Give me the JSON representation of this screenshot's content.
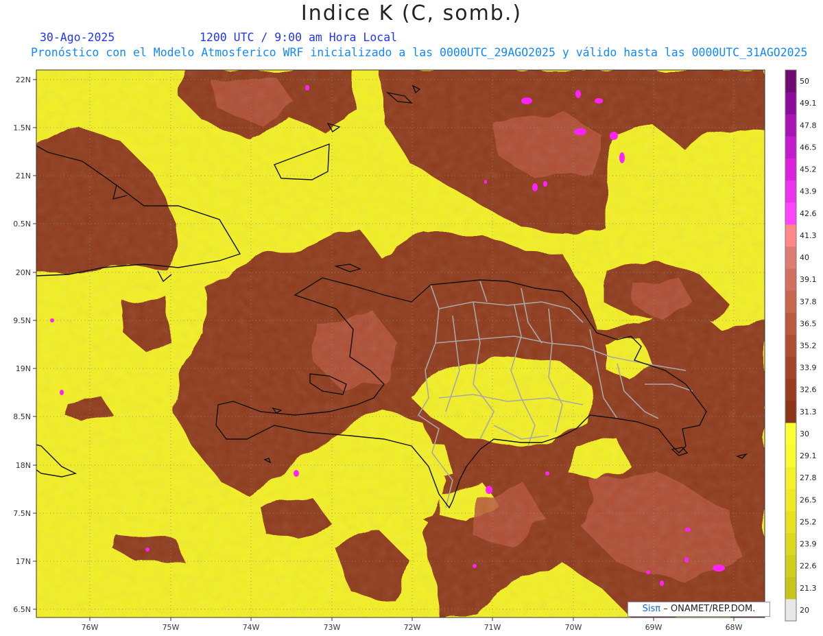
{
  "title": "Indice K (C, somb.)",
  "date_label": "30-Ago-2025",
  "time_label": "1200 UTC / 9:00 am Hora Local",
  "model_label": "Pronóstico con el Modelo Atmosferico WRF inicializado a las 0000UTC_29AGO2025 y válido hasta las  0000UTC_31AGO2025",
  "credit": {
    "logo": "Sisπ",
    "text": "– ONAMET/REP.DOM."
  },
  "axes": {
    "lat_labels": [
      "22N",
      "1.5N",
      "21N",
      "0.5N",
      "20N",
      "9.5N",
      "19N",
      "8.5N",
      "18N",
      "7.5N",
      "17N",
      "6.5N"
    ],
    "lon_labels": [
      "76W",
      "75W",
      "74W",
      "73W",
      "72W",
      "71W",
      "70W",
      "69W",
      "68W"
    ]
  },
  "colorbar": {
    "levels": [
      "20",
      "21.3",
      "22.6",
      "23.9",
      "25.2",
      "26.5",
      "27.8",
      "29.1",
      "30",
      "31.3",
      "32.6",
      "33.9",
      "35.2",
      "36.5",
      "37.8",
      "39.1",
      "40",
      "41.3",
      "42.6",
      "43.9",
      "45.2",
      "46.5",
      "47.8",
      "49.1",
      "50"
    ],
    "colors": [
      "#e8e8e8",
      "#c8c41c",
      "#d2ce1e",
      "#dcd820",
      "#e6e222",
      "#eeea26",
      "#f4f02a",
      "#fafa30",
      "#ffff33",
      "#8c3418",
      "#983c20",
      "#a44428",
      "#b04e34",
      "#bc5a40",
      "#c8664e",
      "#d47060",
      "#e07c74",
      "#ff8888",
      "#ff44ff",
      "#ee33ee",
      "#dd22dd",
      "#c41ccc",
      "#aa14b4",
      "#8e0c9c",
      "#6e0a70"
    ]
  },
  "colors": {
    "yellow": "#f2ef25",
    "brown": "#8f3a1c",
    "brown_light": "#b5523b",
    "magenta": "#ff22ff",
    "coast": "#111111",
    "provinces": "#a8a8a8"
  }
}
